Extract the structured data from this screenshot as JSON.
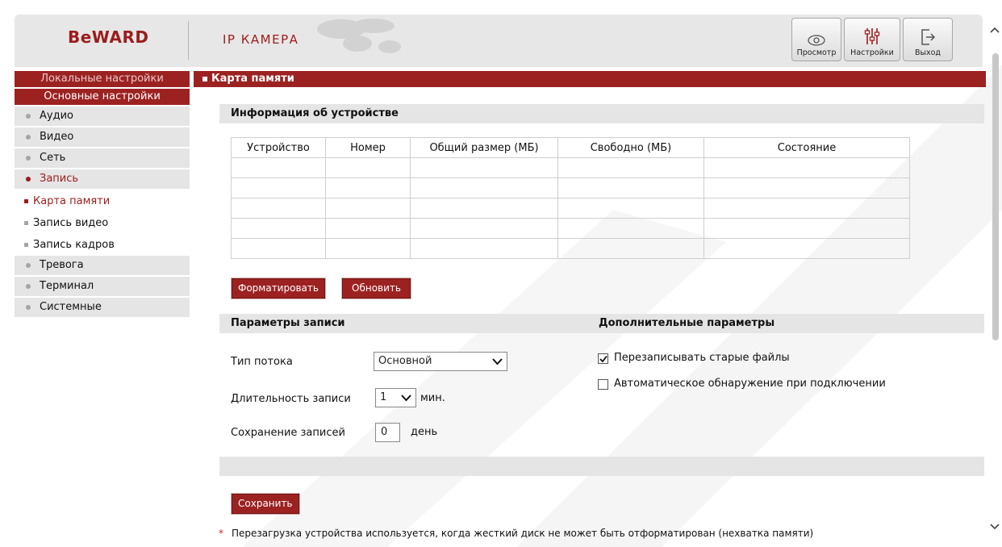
{
  "header": {
    "logo": "BeWARD",
    "product": "IP КАМЕРА",
    "buttons": [
      {
        "label": "Просмотр",
        "icon": "eye-icon"
      },
      {
        "label": "Настройки",
        "icon": "sliders-icon"
      },
      {
        "label": "Выход",
        "icon": "logout-icon"
      }
    ]
  },
  "sidebar": {
    "local_settings": "Локальные настройки",
    "basic_settings": "Основные настройки",
    "items": [
      {
        "label": "Аудио"
      },
      {
        "label": "Видео"
      },
      {
        "label": "Сеть"
      },
      {
        "label": "Запись",
        "active": true
      },
      {
        "label": "Тревога"
      },
      {
        "label": "Терминал"
      },
      {
        "label": "Системные"
      }
    ],
    "record_sub": [
      {
        "label": "Карта памяти",
        "active": true
      },
      {
        "label": "Запись видео"
      },
      {
        "label": "Запись кадров"
      }
    ]
  },
  "main": {
    "title": "Карта памяти",
    "device_info": {
      "heading": "Информация об устройстве",
      "columns": [
        "Устройство",
        "Номер",
        "Общий размер (МБ)",
        "Свободно (МБ)",
        "Состояние"
      ],
      "rows": [
        [
          "",
          "",
          "",
          "",
          ""
        ],
        [
          "",
          "",
          "",
          "",
          ""
        ],
        [
          "",
          "",
          "",
          "",
          ""
        ],
        [
          "",
          "",
          "",
          "",
          ""
        ],
        [
          "",
          "",
          "",
          "",
          ""
        ]
      ]
    },
    "format_button": "Форматировать",
    "refresh_button": "Обновить",
    "record_params": {
      "heading": "Параметры записи",
      "stream_type_label": "Тип потока",
      "stream_type_value": "Основной",
      "duration_label": "Длительность записи",
      "duration_value": "1",
      "duration_unit": "мин.",
      "retention_label": "Сохранение записей",
      "retention_value": "0",
      "retention_unit": "день"
    },
    "extra_params": {
      "heading": "Дополнительные параметры",
      "overwrite_label": "Перезаписывать старые файлы",
      "overwrite_checked": true,
      "autodetect_label": "Автоматическое обнаружение при подключении",
      "autodetect_checked": false
    },
    "save_button": "Сохранить",
    "note_asterisk": "*",
    "note": "Перезагрузка устройства используется, когда жесткий диск не может быть отформатирован (нехватка памяти)"
  },
  "colors": {
    "accent": "#9c2222",
    "panel": "#e5e5e5"
  }
}
